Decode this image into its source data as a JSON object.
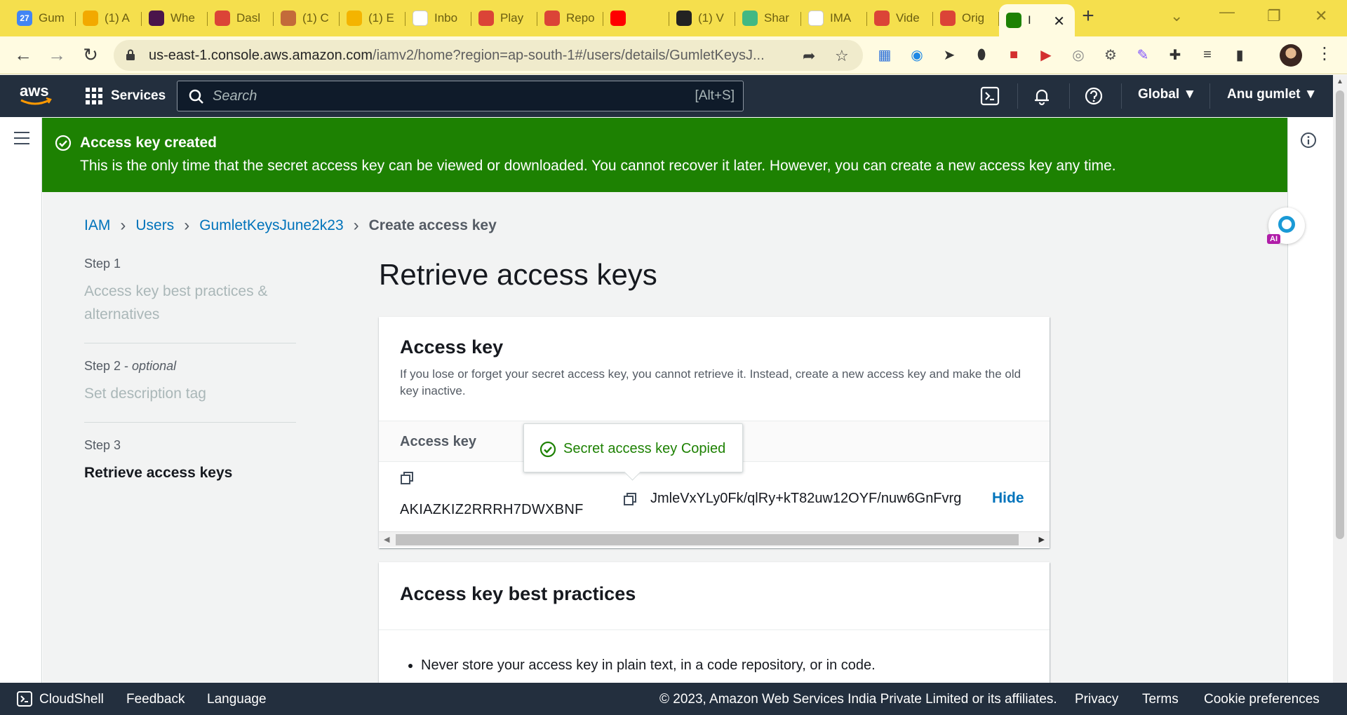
{
  "browser": {
    "tabs": [
      {
        "title": "Gum",
        "icon": "calendar-icon",
        "icon_label": "27",
        "color": "#4285f4"
      },
      {
        "title": "(1) A",
        "icon": "bolt-icon",
        "color": "#f2a900"
      },
      {
        "title": "Whe",
        "icon": "slack-icon",
        "color": "#4a154b"
      },
      {
        "title": "Dasl",
        "icon": "chrome-icon",
        "color": "#db4437"
      },
      {
        "title": "(1) C",
        "icon": "person-icon",
        "color": "#c36b3a"
      },
      {
        "title": "(1) E",
        "icon": "star-icon",
        "color": "#f4b400"
      },
      {
        "title": "Inbo",
        "icon": "gmail-icon",
        "color": "#ffffff"
      },
      {
        "title": "Play",
        "icon": "chrome-icon",
        "color": "#db4437"
      },
      {
        "title": "Repo",
        "icon": "chrome-icon",
        "color": "#db4437"
      },
      {
        "title": "",
        "icon": "youtube-icon",
        "color": "#ff0000"
      },
      {
        "title": "(1) V",
        "icon": "sunglasses-icon",
        "color": "#222222"
      },
      {
        "title": "Shar",
        "icon": "vuetify-icon",
        "color": "#42b883"
      },
      {
        "title": "IMA",
        "icon": "google-icon",
        "color": "#ffffff"
      },
      {
        "title": "Vide",
        "icon": "chrome-icon",
        "color": "#db4437"
      },
      {
        "title": "Orig",
        "icon": "chrome-icon",
        "color": "#db4437"
      },
      {
        "title": "I",
        "icon": "aws-key-icon",
        "color": "#1d8102",
        "active": true
      }
    ],
    "url_host": "us-east-1.console.aws.amazon.com",
    "url_path": "/iamv2/home?region=ap-south-1#/users/details/GumletKeysJ...",
    "extensions": [
      "m-extension-icon",
      "screencast-icon",
      "send-icon",
      "disk-icon",
      "record-icon",
      "video-icon",
      "camera-icon",
      "puzzle-gear-icon",
      "feather-icon",
      "puzzle-icon",
      "playlist-icon",
      "sidepanel-icon"
    ],
    "ext_badge": "1"
  },
  "aws": {
    "services_label": "Services",
    "search_placeholder": "Search",
    "search_shortcut": "[Alt+S]",
    "region": "Global",
    "user": "Anu gumlet"
  },
  "flash": {
    "title": "Access key created",
    "message": "This is the only time that the secret access key can be viewed or downloaded. You cannot recover it later. However, you can create a new access key any time."
  },
  "breadcrumb": {
    "items": [
      "IAM",
      "Users",
      "GumletKeysJune2k23"
    ],
    "current": "Create access key"
  },
  "steps": [
    {
      "num": "Step 1",
      "optional": "",
      "name": "Access key best practices & alternatives",
      "active": false
    },
    {
      "num": "Step 2",
      "optional": "optional",
      "name": "Set description tag",
      "active": false
    },
    {
      "num": "Step 3",
      "optional": "",
      "name": "Retrieve access keys",
      "active": true
    }
  ],
  "page_title": "Retrieve access keys",
  "access_key_panel": {
    "title": "Access key",
    "description": "If you lose or forget your secret access key, you cannot retrieve it. Instead, create a new access key and make the old key inactive.",
    "column_header": "Access key",
    "access_key_id": "AKIAZKIZ2RRRH7DWXBNF",
    "secret_key": "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",
    "hide_label": "Hide",
    "copied_message": "Secret access key Copied"
  },
  "best_practices_panel": {
    "title": "Access key best practices",
    "items": [
      "Never store your access key in plain text, in a code repository, or in code."
    ]
  },
  "ai_badge": "AI",
  "footer": {
    "cloudshell": "CloudShell",
    "feedback": "Feedback",
    "language": "Language",
    "copyright": "© 2023, Amazon Web Services India Private Limited or its affiliates.",
    "privacy": "Privacy",
    "terms": "Terms",
    "cookies": "Cookie preferences"
  }
}
